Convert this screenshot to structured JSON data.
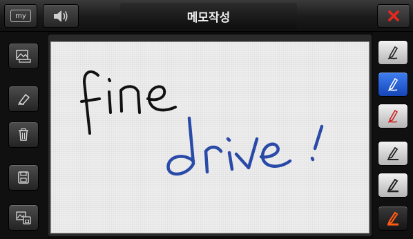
{
  "header": {
    "title": "메모작성",
    "my_label": "my"
  },
  "icons": {
    "my": "my-button-icon",
    "volume": "volume-icon",
    "close": "close-icon",
    "image": "image-icon",
    "eraser": "eraser-icon",
    "trash": "trash-icon",
    "save": "save-icon",
    "save_image": "save-image-icon",
    "pen": "pen-icon"
  },
  "canvas": {
    "handwriting": [
      {
        "text": "fine",
        "color": "#111111"
      },
      {
        "text": "drive !",
        "color": "#2a4aa8"
      }
    ]
  },
  "pens": [
    {
      "name": "pen-black-thin",
      "color": "#222222",
      "selected": false
    },
    {
      "name": "pen-blue-thin",
      "color": "#ffffff",
      "selected": true
    },
    {
      "name": "pen-red-thin",
      "color": "#cc2222",
      "selected": false
    },
    {
      "name": "pen-black-medium",
      "color": "#222222",
      "selected": false
    },
    {
      "name": "pen-black-thick",
      "color": "#222222",
      "selected": false
    },
    {
      "name": "pen-orange-thick",
      "color": "#ff5a14",
      "selected": false
    }
  ],
  "colors": {
    "accent_blue": "#2a5fd8",
    "close_red": "#e8281e",
    "ink_black": "#111111",
    "ink_blue": "#2a4aa8"
  }
}
